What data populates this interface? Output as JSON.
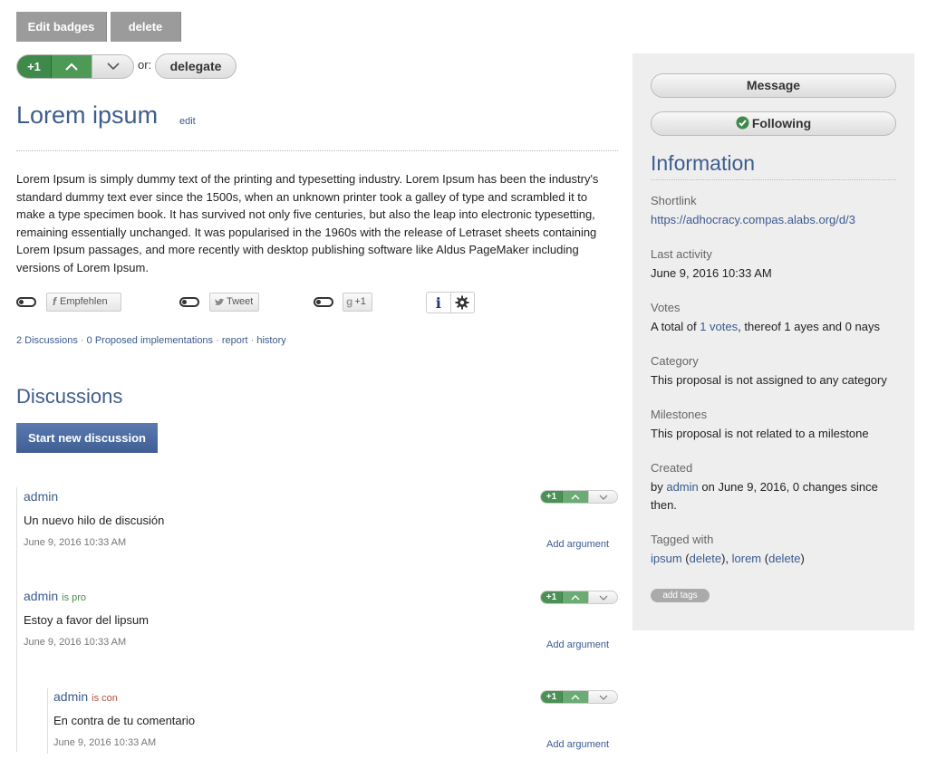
{
  "admin_buttons": {
    "edit_badges": "Edit badges",
    "delete": "delete"
  },
  "proposal_vote": {
    "plus_label": "+1",
    "or_label": "or:",
    "delegate": "delegate"
  },
  "proposal": {
    "title": "Lorem ipsum",
    "edit_link": "edit",
    "body": "Lorem Ipsum is simply dummy text of the printing and typesetting industry. Lorem Ipsum has been the industry's standard dummy text ever since the 1500s, when an unknown printer took a galley of type and scrambled it to make a type specimen book. It has survived not only five centuries, but also the leap into electronic typesetting, remaining essentially unchanged. It was popularised in the 1960s with the release of Letraset sheets containing Lorem Ipsum passages, and more recently with desktop publishing software like Aldus PageMaker including versions of Lorem Ipsum."
  },
  "share": {
    "facebook": "Empfehlen",
    "twitter": "Tweet",
    "gplus": "+1"
  },
  "links": {
    "discussions": "2 Discussions",
    "implementations": "0 Proposed implementations",
    "report": "report",
    "history": "history",
    "sep": " · "
  },
  "discussions": {
    "heading": "Discussions",
    "start_button": "Start new discussion",
    "comments": [
      {
        "author": "admin",
        "tag": "",
        "text": "Un nuevo hilo de discusión",
        "date": "June 9, 2016 10:33 AM",
        "add": "Add argument",
        "vote": "+1"
      },
      {
        "author": "admin",
        "tag": "is pro",
        "text": "Estoy a favor del lipsum",
        "date": "June 9, 2016 10:33 AM",
        "add": "Add argument",
        "vote": "+1"
      },
      {
        "author": "admin",
        "tag": "is con",
        "text": "En contra de tu comentario",
        "date": "June 9, 2016 10:33 AM",
        "add": "Add argument",
        "vote": "+1"
      }
    ]
  },
  "sidebar": {
    "message": "Message",
    "following": "Following",
    "info_title": "Information",
    "shortlink_label": "Shortlink",
    "shortlink": "https://adhocracy.compas.alabs.org/d/3",
    "last_activity_label": "Last activity",
    "last_activity": "June 9, 2016 10:33 AM",
    "votes_label": "Votes",
    "votes_pre": "A total of ",
    "votes_link": "1 votes",
    "votes_post": ", thereof 1 ayes and 0 nays",
    "category_label": "Category",
    "category": "This proposal is not assigned to any category",
    "milestones_label": "Milestones",
    "milestones": "This proposal is not related to a milestone",
    "created_label": "Created",
    "created_pre": "by ",
    "created_author": "admin",
    "created_post": " on June 9, 2016, 0 changes since then.",
    "tagged_label": "Tagged with",
    "tags": [
      {
        "name": "ipsum",
        "delete": "delete"
      },
      {
        "name": "lorem",
        "delete": "delete"
      }
    ],
    "add_tags": "add tags"
  },
  "colors": {
    "heading": "#3e5d8e",
    "link": "#3a5a90",
    "vote_green": "#3f8a4a",
    "sidebar_bg": "#eeeeee"
  }
}
